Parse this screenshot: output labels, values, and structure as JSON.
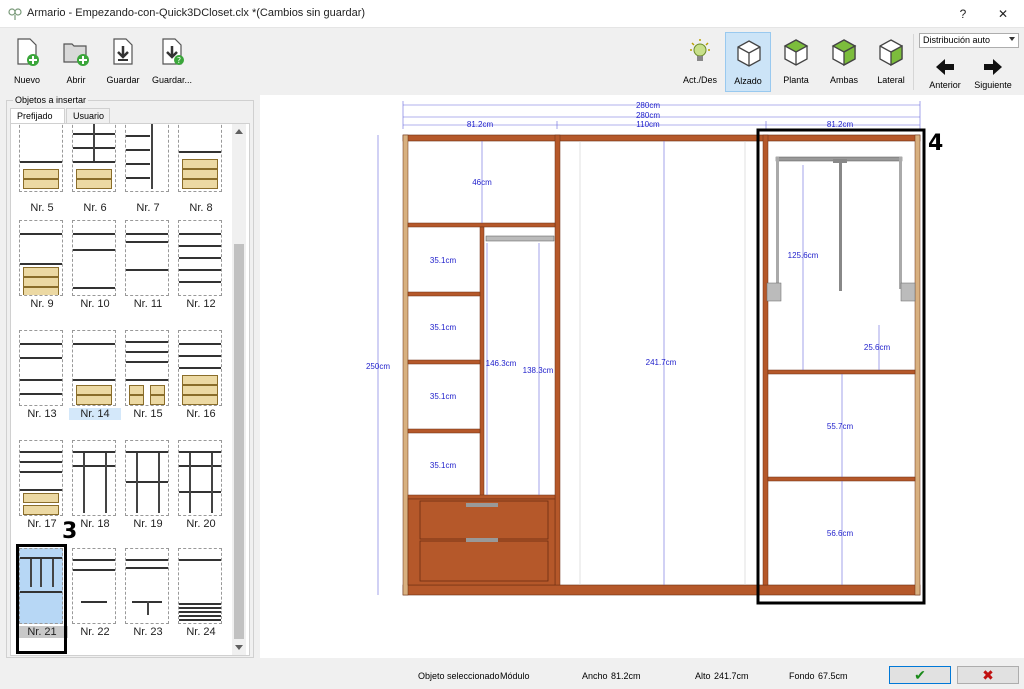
{
  "window": {
    "title": "Armario - Empezando-con-Quick3DCloset.clx *(Cambios sin guardar)",
    "help": "?",
    "close": "✕"
  },
  "toolbar": {
    "new": "Nuevo",
    "open": "Abrir",
    "save": "Guardar",
    "save_as": "Guardar...",
    "toggle": "Act./Des",
    "elevation": "Alzado",
    "plan": "Planta",
    "both": "Ambas",
    "side": "Lateral",
    "previous": "Anterior",
    "next": "Siguiente",
    "distribution": "Distribución auto"
  },
  "panel": {
    "legend": "Objetos a insertar",
    "tab_predef": "Prefijado",
    "tab_user": "Usuario",
    "items": [
      "Nr. 5",
      "Nr. 6",
      "Nr. 7",
      "Nr. 8",
      "Nr. 9",
      "Nr. 10",
      "Nr. 11",
      "Nr. 12",
      "Nr. 13",
      "Nr. 14",
      "Nr. 15",
      "Nr. 16",
      "Nr. 17",
      "Nr. 18",
      "Nr. 19",
      "Nr. 20",
      "Nr. 21",
      "Nr. 22",
      "Nr. 23",
      "Nr. 24"
    ]
  },
  "markers": {
    "a": "3",
    "b": "4"
  },
  "drawing": {
    "total_width": "280cm",
    "total_width_2": "280cm",
    "middle_width": "110cm",
    "left_width": "81.2cm",
    "right_width": "81.2cm",
    "height": "250cm",
    "left_top": "46cm",
    "cube1": "35.1cm",
    "cube2": "35.1cm",
    "cube3": "35.1cm",
    "cube4": "35.1cm",
    "hang_a": "146.3cm",
    "hang_b": "138.3cm",
    "middle_h": "241.7cm",
    "right_top": "125.6cm",
    "right_gap": "25.6cm",
    "right_mid": "55.7cm",
    "right_bot": "56.6cm"
  },
  "status": {
    "selected_label": "Objeto seleccionado",
    "selected_value": "Módulo",
    "width_label": "Ancho",
    "width_value": "81.2cm",
    "height_label": "Alto",
    "height_value": "241.7cm",
    "depth_label": "Fondo",
    "depth_value": "67.5cm",
    "ok": "✔",
    "cancel": "✖"
  }
}
